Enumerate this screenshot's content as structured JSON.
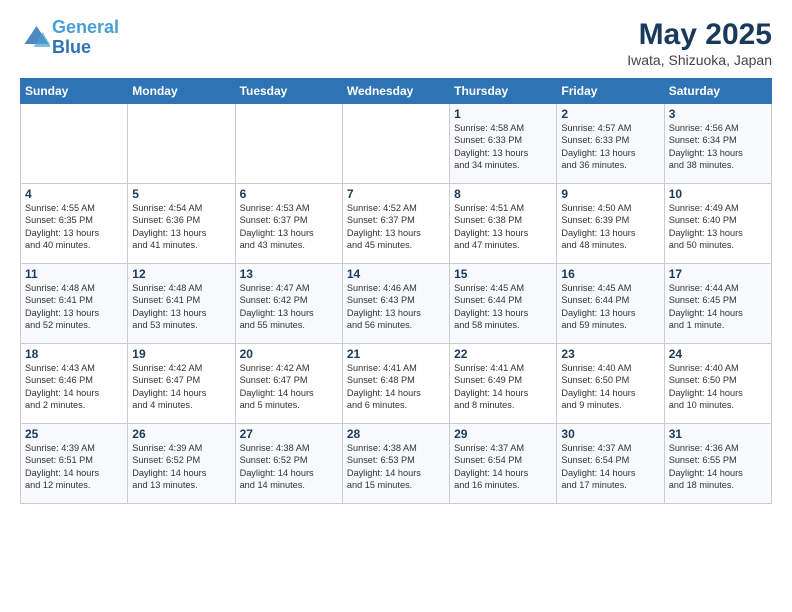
{
  "header": {
    "logo_line1": "General",
    "logo_line2": "Blue",
    "title": "May 2025",
    "location": "Iwata, Shizuoka, Japan"
  },
  "weekdays": [
    "Sunday",
    "Monday",
    "Tuesday",
    "Wednesday",
    "Thursday",
    "Friday",
    "Saturday"
  ],
  "weeks": [
    [
      {
        "day": "",
        "info": ""
      },
      {
        "day": "",
        "info": ""
      },
      {
        "day": "",
        "info": ""
      },
      {
        "day": "",
        "info": ""
      },
      {
        "day": "1",
        "info": "Sunrise: 4:58 AM\nSunset: 6:33 PM\nDaylight: 13 hours\nand 34 minutes."
      },
      {
        "day": "2",
        "info": "Sunrise: 4:57 AM\nSunset: 6:33 PM\nDaylight: 13 hours\nand 36 minutes."
      },
      {
        "day": "3",
        "info": "Sunrise: 4:56 AM\nSunset: 6:34 PM\nDaylight: 13 hours\nand 38 minutes."
      }
    ],
    [
      {
        "day": "4",
        "info": "Sunrise: 4:55 AM\nSunset: 6:35 PM\nDaylight: 13 hours\nand 40 minutes."
      },
      {
        "day": "5",
        "info": "Sunrise: 4:54 AM\nSunset: 6:36 PM\nDaylight: 13 hours\nand 41 minutes."
      },
      {
        "day": "6",
        "info": "Sunrise: 4:53 AM\nSunset: 6:37 PM\nDaylight: 13 hours\nand 43 minutes."
      },
      {
        "day": "7",
        "info": "Sunrise: 4:52 AM\nSunset: 6:37 PM\nDaylight: 13 hours\nand 45 minutes."
      },
      {
        "day": "8",
        "info": "Sunrise: 4:51 AM\nSunset: 6:38 PM\nDaylight: 13 hours\nand 47 minutes."
      },
      {
        "day": "9",
        "info": "Sunrise: 4:50 AM\nSunset: 6:39 PM\nDaylight: 13 hours\nand 48 minutes."
      },
      {
        "day": "10",
        "info": "Sunrise: 4:49 AM\nSunset: 6:40 PM\nDaylight: 13 hours\nand 50 minutes."
      }
    ],
    [
      {
        "day": "11",
        "info": "Sunrise: 4:48 AM\nSunset: 6:41 PM\nDaylight: 13 hours\nand 52 minutes."
      },
      {
        "day": "12",
        "info": "Sunrise: 4:48 AM\nSunset: 6:41 PM\nDaylight: 13 hours\nand 53 minutes."
      },
      {
        "day": "13",
        "info": "Sunrise: 4:47 AM\nSunset: 6:42 PM\nDaylight: 13 hours\nand 55 minutes."
      },
      {
        "day": "14",
        "info": "Sunrise: 4:46 AM\nSunset: 6:43 PM\nDaylight: 13 hours\nand 56 minutes."
      },
      {
        "day": "15",
        "info": "Sunrise: 4:45 AM\nSunset: 6:44 PM\nDaylight: 13 hours\nand 58 minutes."
      },
      {
        "day": "16",
        "info": "Sunrise: 4:45 AM\nSunset: 6:44 PM\nDaylight: 13 hours\nand 59 minutes."
      },
      {
        "day": "17",
        "info": "Sunrise: 4:44 AM\nSunset: 6:45 PM\nDaylight: 14 hours\nand 1 minute."
      }
    ],
    [
      {
        "day": "18",
        "info": "Sunrise: 4:43 AM\nSunset: 6:46 PM\nDaylight: 14 hours\nand 2 minutes."
      },
      {
        "day": "19",
        "info": "Sunrise: 4:42 AM\nSunset: 6:47 PM\nDaylight: 14 hours\nand 4 minutes."
      },
      {
        "day": "20",
        "info": "Sunrise: 4:42 AM\nSunset: 6:47 PM\nDaylight: 14 hours\nand 5 minutes."
      },
      {
        "day": "21",
        "info": "Sunrise: 4:41 AM\nSunset: 6:48 PM\nDaylight: 14 hours\nand 6 minutes."
      },
      {
        "day": "22",
        "info": "Sunrise: 4:41 AM\nSunset: 6:49 PM\nDaylight: 14 hours\nand 8 minutes."
      },
      {
        "day": "23",
        "info": "Sunrise: 4:40 AM\nSunset: 6:50 PM\nDaylight: 14 hours\nand 9 minutes."
      },
      {
        "day": "24",
        "info": "Sunrise: 4:40 AM\nSunset: 6:50 PM\nDaylight: 14 hours\nand 10 minutes."
      }
    ],
    [
      {
        "day": "25",
        "info": "Sunrise: 4:39 AM\nSunset: 6:51 PM\nDaylight: 14 hours\nand 12 minutes."
      },
      {
        "day": "26",
        "info": "Sunrise: 4:39 AM\nSunset: 6:52 PM\nDaylight: 14 hours\nand 13 minutes."
      },
      {
        "day": "27",
        "info": "Sunrise: 4:38 AM\nSunset: 6:52 PM\nDaylight: 14 hours\nand 14 minutes."
      },
      {
        "day": "28",
        "info": "Sunrise: 4:38 AM\nSunset: 6:53 PM\nDaylight: 14 hours\nand 15 minutes."
      },
      {
        "day": "29",
        "info": "Sunrise: 4:37 AM\nSunset: 6:54 PM\nDaylight: 14 hours\nand 16 minutes."
      },
      {
        "day": "30",
        "info": "Sunrise: 4:37 AM\nSunset: 6:54 PM\nDaylight: 14 hours\nand 17 minutes."
      },
      {
        "day": "31",
        "info": "Sunrise: 4:36 AM\nSunset: 6:55 PM\nDaylight: 14 hours\nand 18 minutes."
      }
    ]
  ]
}
